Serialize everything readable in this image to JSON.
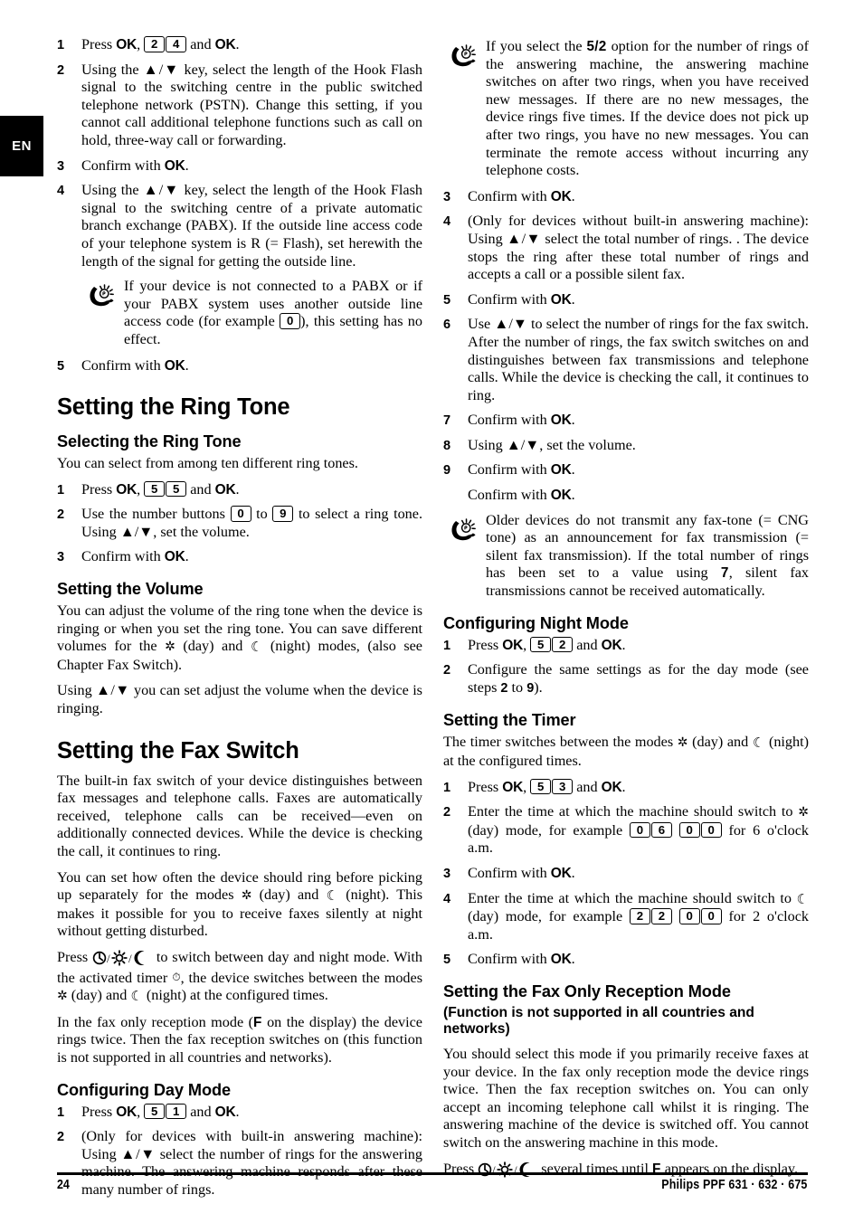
{
  "page": {
    "language_tab": "EN",
    "footer_page_number": "24",
    "footer_product_line": "Philips PPF 631 · 632 · 675"
  },
  "left_column": {
    "steps_hook_flash": [
      {
        "num": "1",
        "text_before_keys": "Press ",
        "ok1": "OK",
        "comma": ", ",
        "keys": [
          "2",
          "4"
        ],
        "text_mid": " and ",
        "ok2": "OK",
        "text_end": "."
      },
      {
        "num": "2",
        "text": "Using the ▲/▼ key, select the length of the Hook Flash signal to the switching centre in the public switched telephone network (PSTN). Change this setting, if you cannot call additional telephone functions such as call on hold, three-way call or forwarding."
      },
      {
        "num": "3",
        "text": "Confirm with OK."
      },
      {
        "num": "4",
        "text": "Using the ▲/▼ key, select the length of the Hook Flash signal to the switching centre of a private automatic branch exchange (PABX). If the outside line access code of your telephone system is R (= Flash), set herewith the length of the signal for getting the outside line."
      }
    ],
    "tip_pabx": {
      "part1": "If your device is not connected to a PABX or if your PABX system uses another outside line access code (for example ",
      "key": "0",
      "part2": "), this setting has no effect."
    },
    "step_5_hook": {
      "num": "5",
      "text": "Confirm with OK."
    },
    "heading_ring_tone": "Setting the Ring Tone",
    "heading_selecting_ring_tone": "Selecting the Ring Tone",
    "ring_tone_intro": "You can select from among ten different ring tones.",
    "ring_tone_steps": [
      {
        "num": "1",
        "keys": [
          "5",
          "5"
        ]
      },
      {
        "num": "2",
        "key_from": "0",
        "key_to": "9"
      },
      {
        "num": "3",
        "text": "Confirm with OK."
      }
    ],
    "heading_setting_volume": "Setting the Volume",
    "volume_para_1_a": "You can adjust the volume of the ring tone when the device is ringing or when you set the ring tone. You can save different volumes for the ",
    "volume_para_1_b": " (day) and ",
    "volume_para_1_c": " (night) modes, (also see Chapter Fax Switch).",
    "volume_para_2": "Using ▲/▼ you can set adjust the volume when the device is ringing.",
    "heading_fax_switch": "Setting the Fax Switch",
    "fax_switch_para_1": "The built-in fax switch of your device distinguishes between fax messages and telephone calls. Faxes are automatically received, telephone calls can be received—even on additionally connected devices. While the device is checking the call, it continues to ring.",
    "fax_switch_para_2_a": "You can set how often the device should ring before picking up separately for the modes ",
    "fax_switch_para_2_b": " (day) and ",
    "fax_switch_para_2_c": " (night). This makes it possible for you to receive faxes silently at night without getting disturbed.",
    "fax_switch_para_3_a": "Press ",
    "fax_switch_para_3_b": " to switch between day and night mode. With the activated timer ",
    "fax_switch_para_3_c": ", the device switches between the modes ",
    "fax_switch_para_3_d": " (day) and ",
    "fax_switch_para_3_e": " (night) at the configured times.",
    "fax_switch_para_4_a": "In the fax only reception mode (",
    "fax_switch_para_4_display": "F",
    "fax_switch_para_4_b": " on the display) the device rings twice. Then the fax reception switches on (this function is not supported in all countries and networks).",
    "heading_day_mode": "Configuring Day Mode",
    "day_mode_steps": [
      {
        "num": "1",
        "keys": [
          "5",
          "1"
        ]
      },
      {
        "num": "2",
        "text": "(Only for devices with built-in answering machine): Using ▲/▼ select the number of rings for the answering machine. The answering machine responds after these many number of rings."
      }
    ]
  },
  "right_column": {
    "tip_ring_option": {
      "part1": "If you select the ",
      "display": "5/2",
      "part2": " option for the number of rings of the answering machine, the answering machine switches on after two rings, when you have received new messages. If there are no new messages, the device rings five times. If the device does not pick up after two rings, you have no new messages. You can terminate the remote access without incurring any telephone costs."
    },
    "day_mode_steps_cont": [
      {
        "num": "3",
        "text": "Confirm with OK."
      },
      {
        "num": "4",
        "text": "(Only for devices without built-in answering machine): Using ▲/▼ select the total number of rings. . The device stops the ring after these total number of rings and accepts a call or a possible silent fax."
      },
      {
        "num": "5",
        "text": "Confirm with OK."
      },
      {
        "num": "6",
        "text": "Use ▲/▼ to select the number of rings for the fax switch. After the number of rings, the fax switch switches on and distinguishes between fax transmissions and telephone calls. While the device is checking the call, it continues to ring."
      },
      {
        "num": "7",
        "text": "Confirm with OK."
      },
      {
        "num": "8",
        "text": "Using ▲/▼, set the volume."
      },
      {
        "num": "9",
        "text": "Confirm with OK."
      }
    ],
    "tip_older_devices": {
      "part1": "Older devices do not transmit any fax-tone (= CNG tone) as an announcement for fax transmission (= silent fax transmission). If the total number of rings has been set to a value using ",
      "display": "7",
      "part2": ", silent fax transmissions cannot be received automatically."
    },
    "heading_night_mode": "Configuring Night Mode",
    "night_mode_steps": [
      {
        "num": "1",
        "keys": [
          "5",
          "2"
        ]
      },
      {
        "num": "2",
        "text_a": "Configure the same settings as for the day mode (see steps ",
        "bold_from": "2",
        "text_b": " to ",
        "bold_to": "9",
        "text_c": ")."
      }
    ],
    "heading_timer": "Setting the Timer",
    "timer_intro_a": "The timer switches between the modes ",
    "timer_intro_b": " (day) and ",
    "timer_intro_c": " (night) at the configured times.",
    "timer_steps": [
      {
        "num": "1",
        "keys": [
          "5",
          "3"
        ]
      },
      {
        "num": "2",
        "text_a": "Enter the time at which the machine should switch to ",
        "text_b": " (day) mode, for example ",
        "keys_hour": [
          "0",
          "6"
        ],
        "keys_min": [
          "0",
          "0"
        ],
        "text_c": " for 6 o'clock a.m."
      },
      {
        "num": "3",
        "text": "Confirm with OK."
      },
      {
        "num": "4",
        "text_a": "Enter the time at which the machine should switch to ",
        "text_b": " (day) mode, for example ",
        "keys_hour": [
          "2",
          "2"
        ],
        "keys_min": [
          "0",
          "0"
        ],
        "text_c": " for 2 o'clock a.m."
      },
      {
        "num": "5",
        "text": "Confirm with OK."
      }
    ],
    "heading_fax_only": "Setting the Fax Only Reception Mode",
    "heading_fax_only_sub": "(Function is not supported in all countries and networks)",
    "fax_only_para_1": "You should select this mode if you primarily receive faxes at your device. In the fax only reception mode the device rings twice. Then the fax reception switches on. You can only accept an incoming telephone call whilst it is ringing. The answering machine of the device is switched off. You cannot switch on the answering machine in this mode.",
    "fax_only_para_2_a": "Press ",
    "fax_only_para_2_b": " several times until ",
    "fax_only_display": "F",
    "fax_only_para_2_c": " appears on the display."
  },
  "shared_labels": {
    "ok": "OK",
    "press": "Press ",
    "and": " and ",
    "period": ".",
    "comma": ", ",
    "confirm_with": "Confirm with ",
    "use_number_buttons": "Use the number buttons ",
    "to": " to ",
    "select_ring_tone_tail": " to select a ring tone. Using ▲/▼, set the volume."
  }
}
